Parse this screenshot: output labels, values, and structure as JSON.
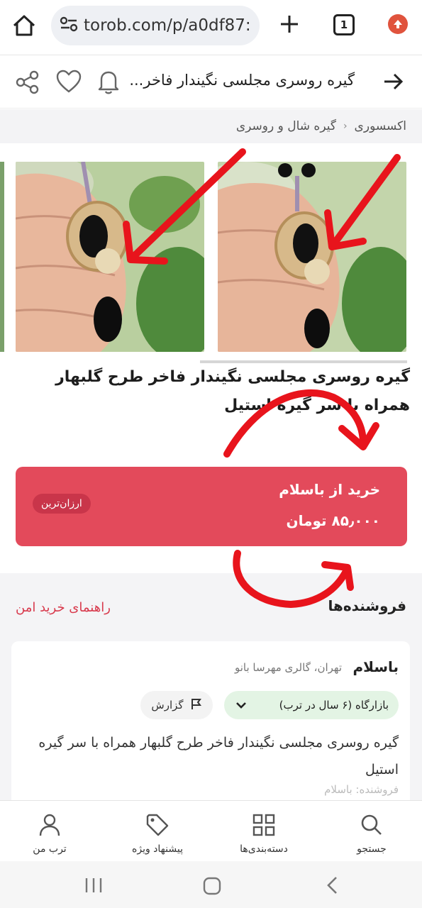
{
  "browser": {
    "url": "torob.com/p/a0df87:",
    "tab_count": "1"
  },
  "header": {
    "title": "گیره روسری مجلسی نگیندار فاخر..."
  },
  "breadcrumb": {
    "items": [
      "اکسسوری",
      "گیره شال و روسری"
    ]
  },
  "product": {
    "title": "گیره روسری مجلسی نگیندار فاخر طرح گلبهار همراه با سر گیره استیل"
  },
  "buy_box": {
    "store_label": "خرید از باسلام",
    "price": "۸۵٫۰۰۰ تومان",
    "badge": "ارزان‌ترین"
  },
  "sellers": {
    "title": "فروشنده‌ها",
    "safe_guide": "راهنمای خرید امن",
    "card": {
      "name": "باسلام",
      "location": "تهران، گالری مهرسا بانو",
      "market_badge": "بازارگاه (۶ سال در ترب)",
      "report": "گزارش",
      "description": "گیره روسری مجلسی نگیندار فاخر طرح گلبهار همراه با سر گیره استیل",
      "more": "فروشنده: باسلام"
    }
  },
  "bottom_nav": {
    "items": [
      {
        "label": "جستجو",
        "icon": "search-icon"
      },
      {
        "label": "دسته‌بندی‌ها",
        "icon": "grid-icon"
      },
      {
        "label": "پیشنهاد ویژه",
        "icon": "tag-icon"
      },
      {
        "label": "ترب من",
        "icon": "user-icon"
      }
    ]
  },
  "colors": {
    "accent": "#e34a5b",
    "annotation": "#e8141c"
  }
}
